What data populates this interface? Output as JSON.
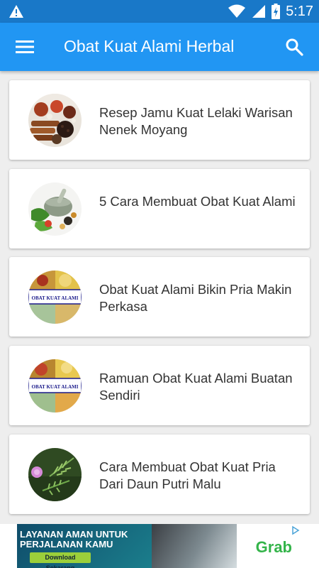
{
  "status_bar": {
    "time": "5:17",
    "icons": [
      "warning-icon",
      "wifi-icon",
      "cell-signal-icon",
      "battery-icon"
    ]
  },
  "app_bar": {
    "title": "Obat Kuat Alami Herbal",
    "menu_icon": "menu-icon",
    "search_icon": "search-icon"
  },
  "articles": [
    {
      "title": "Resep Jamu Kuat Lelaki Warisan Nenek Moyang",
      "thumbnail": "spices"
    },
    {
      "title": "5 Cara Membuat Obat Kuat Alami",
      "thumbnail": "mortar-herbs"
    },
    {
      "title": "Obat Kuat Alami Bikin Pria Makin Perkasa",
      "thumbnail": "obat-kuat-alami-badge",
      "thumb_text": "OBAT KUAT ALAMI"
    },
    {
      "title": "Ramuan Obat Kuat Alami Buatan Sendiri",
      "thumbnail": "obat-kuat-alami-badge",
      "thumb_text": "OBAT KUAT ALAMI"
    },
    {
      "title": "Cara Membuat Obat Kuat Pria Dari Daun Putri Malu",
      "thumbnail": "mimosa-plant"
    }
  ],
  "ad": {
    "headline": "LAYANAN AMAN UNTUK PERJALANAN KAMU",
    "cta": "Download Sekarang",
    "brand": "Grab"
  },
  "colors": {
    "app_bar": "#2196f3",
    "status_bar": "#1978c8",
    "card": "#ffffff",
    "background": "#eeeeee",
    "ad_brand": "#34b44a"
  }
}
